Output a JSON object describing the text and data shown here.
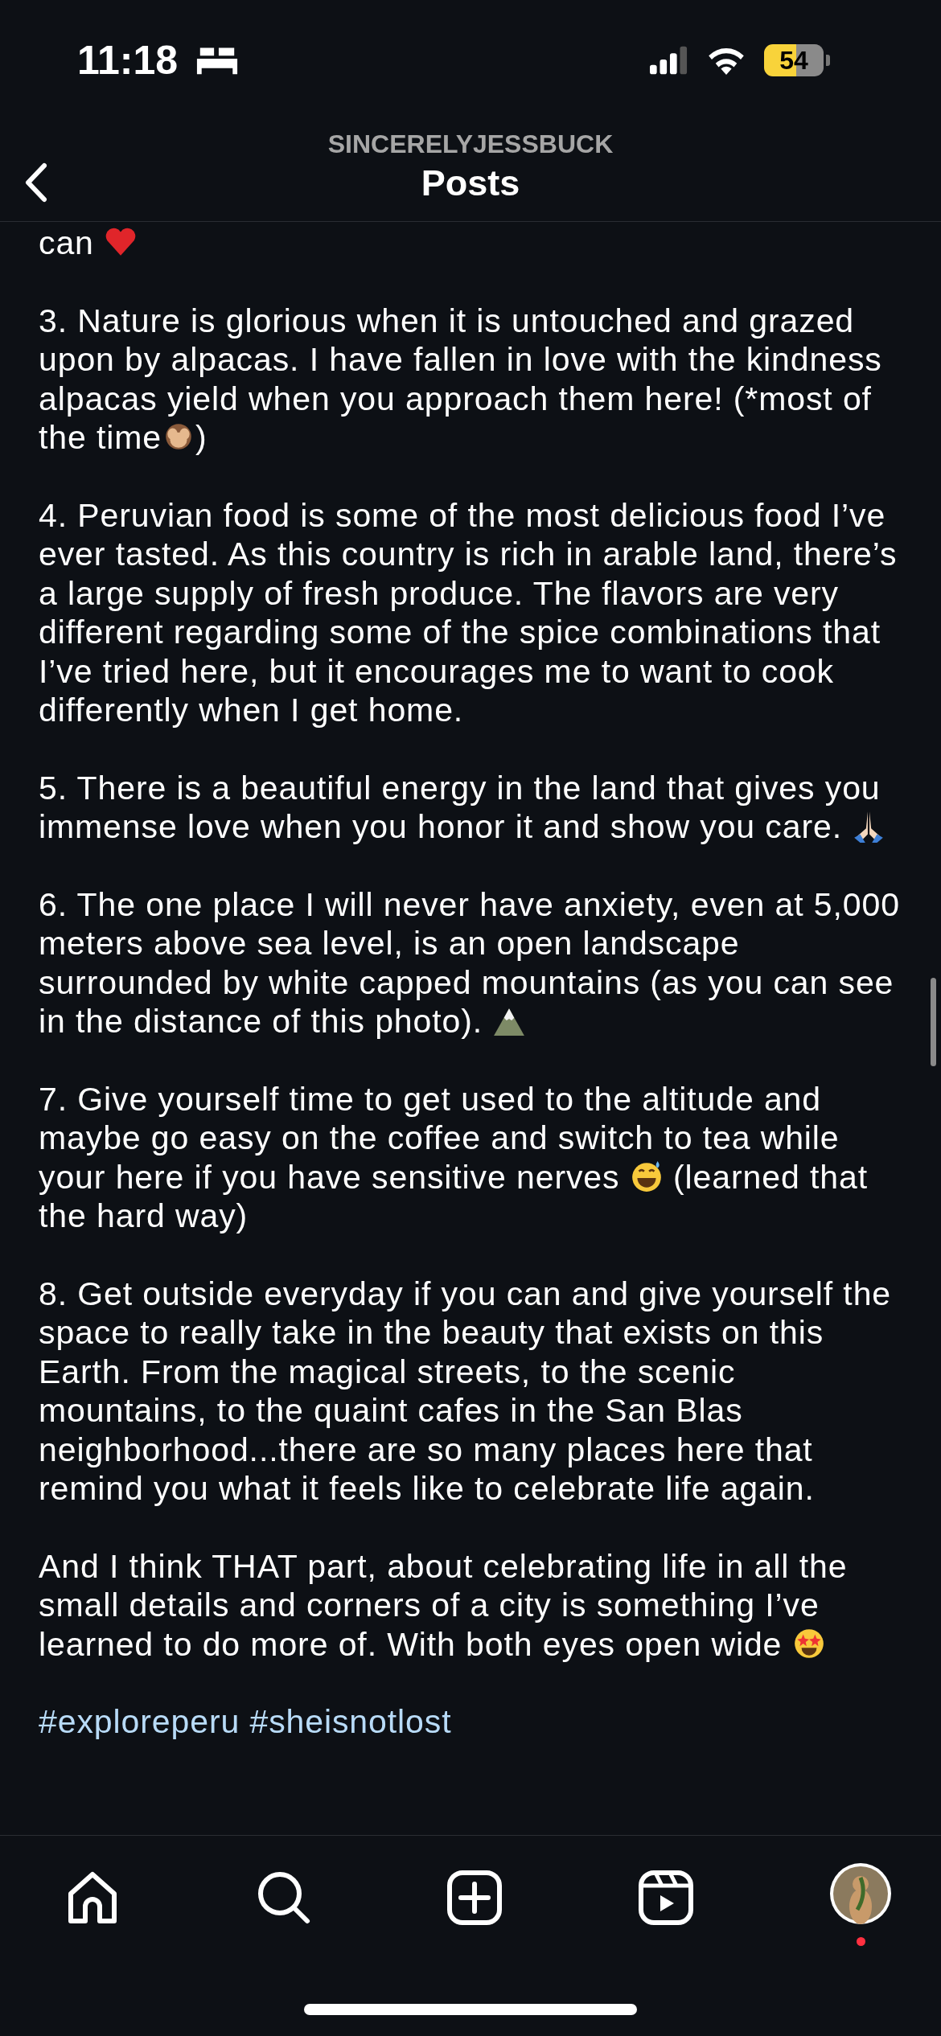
{
  "status_bar": {
    "time": "11:18",
    "battery": "54"
  },
  "header": {
    "username": "SINCERELYJESSBUCK",
    "title": "Posts"
  },
  "paragraphs": [
    [
      {
        "kind": "text",
        "text": "can "
      },
      {
        "kind": "heart"
      }
    ],
    [
      {
        "kind": "text",
        "text": "3. Nature is glorious when it is untouched and grazed upon by alpacas. I have fallen in love with the kindness alpacas yield when you approach them here! (*most of the time"
      },
      {
        "kind": "monkey"
      },
      {
        "kind": "text",
        "text": ")"
      }
    ],
    [
      {
        "kind": "text",
        "text": "4. Peruvian food is some of the most delicious food I’ve ever tasted. As this country is rich in arable land, there’s a large supply of fresh produce. The flavors are very different regarding some of the spice combinations that I’ve tried here, but it encourages me to want to cook differently when I get home."
      }
    ],
    [
      {
        "kind": "text",
        "text": "5. There is a beautiful energy in the land that gives you immense love when you honor it and show you care. "
      },
      {
        "kind": "pray"
      }
    ],
    [
      {
        "kind": "text",
        "text": "6. The one place I will never have anxiety, even at 5,000 meters above sea level, is an open landscape surrounded by white capped mountains (as you can see in the distance of this photo). "
      },
      {
        "kind": "mountain"
      }
    ],
    [
      {
        "kind": "text",
        "text": "7. Give yourself time to get used to the altitude and maybe go easy on the coffee and switch to tea while your here if you have sensitive nerves "
      },
      {
        "kind": "sweat"
      },
      {
        "kind": "text",
        "text": " (learned that the hard way)"
      }
    ],
    [
      {
        "kind": "text",
        "text": "8. Get outside everyday if you can and give yourself the space to really take in the beauty that exists on this Earth. From the magical streets, to the scenic mountains, to the quaint cafes in the San Blas neighborhood...there are so many places here that remind you what it feels like to celebrate life again."
      }
    ],
    [
      {
        "kind": "text",
        "text": "And I think THAT part, about celebrating life in all the small details and corners of a city is something I’ve learned to do more of. With both eyes open wide "
      },
      {
        "kind": "starstruck"
      }
    ]
  ],
  "hashtags": [
    "#exploreperu",
    "#sheisnotlost"
  ],
  "nav": {
    "profile_notification": true
  }
}
